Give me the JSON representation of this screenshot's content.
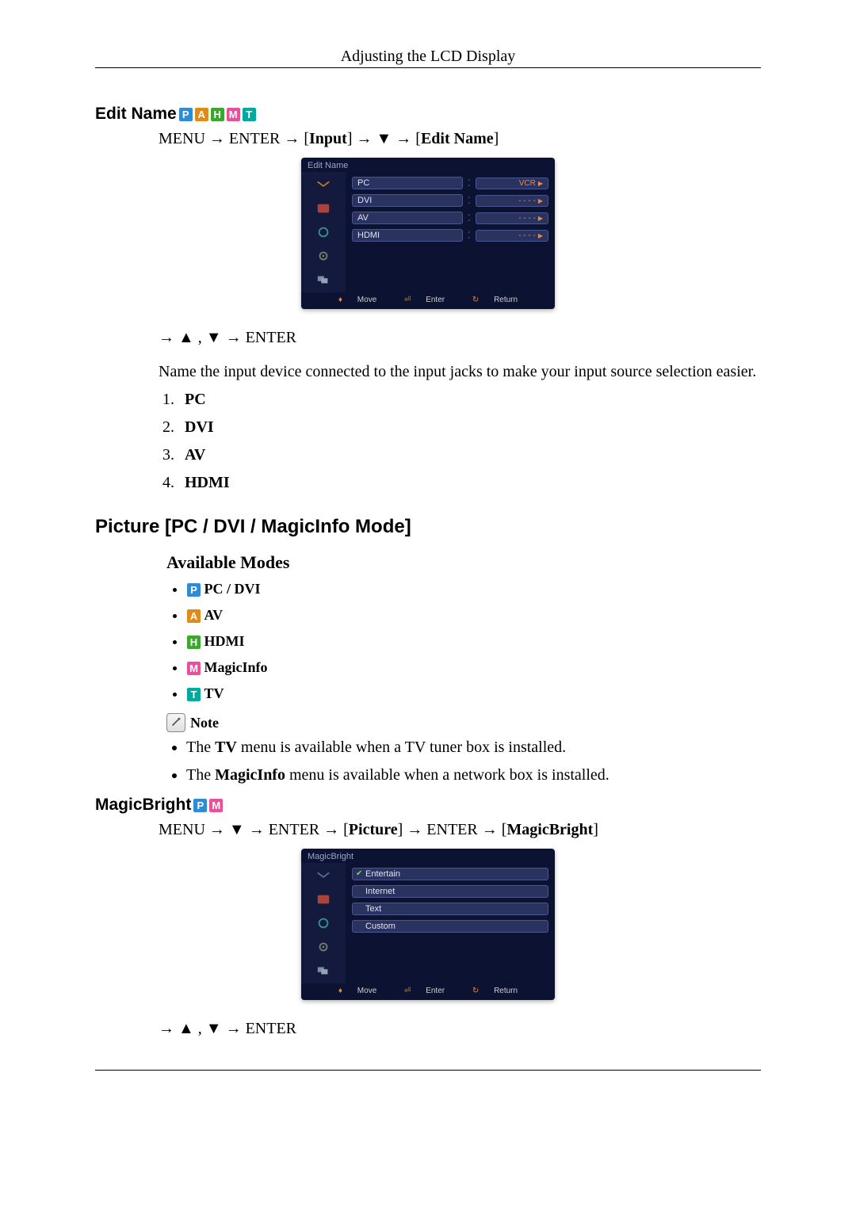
{
  "header": {
    "title": "Adjusting the LCD Display"
  },
  "badges": {
    "P": "P",
    "A": "A",
    "H": "H",
    "M": "M",
    "T": "T"
  },
  "editName": {
    "title": "Edit Name",
    "pathParts": [
      "MENU",
      " → ",
      "ENTER",
      " → [",
      "Input",
      "] → ",
      "▼",
      " → [",
      "Edit Name",
      "]"
    ],
    "osd": {
      "title": "Edit Name",
      "rows": [
        {
          "label": "PC",
          "value": "VCR",
          "arrow": true
        },
        {
          "label": "DVI",
          "value": "- - - -",
          "arrow": true
        },
        {
          "label": "AV",
          "value": "- - - -",
          "arrow": true
        },
        {
          "label": "HDMI",
          "value": "- - - -",
          "arrow": true
        }
      ],
      "footer": {
        "move": "Move",
        "enter": "Enter",
        "return": "Return"
      }
    },
    "navKeys": "→ ▲ , ▼ → ENTER",
    "desc": "Name the input device connected to the input jacks to make your input source selection easier.",
    "list": [
      "PC",
      "DVI",
      "AV",
      "HDMI"
    ]
  },
  "picture": {
    "title": "Picture [PC / DVI / MagicInfo Mode]",
    "modesTitle": "Available Modes",
    "modes": [
      "PC / DVI",
      "AV",
      "HDMI",
      "MagicInfo",
      "TV"
    ],
    "noteLabel": "Note",
    "notes": [
      {
        "pre": "The ",
        "b": "TV",
        "post": " menu is available when a TV tuner box is installed."
      },
      {
        "pre": "The ",
        "b": "MagicInfo",
        "post": " menu is available when a network box is installed."
      }
    ]
  },
  "magicBright": {
    "title": "MagicBright",
    "pathParts": [
      "MENU",
      " → ",
      "▼",
      " → ",
      "ENTER",
      " → [",
      "Picture",
      "] → ",
      "ENTER",
      " → [",
      "MagicBright",
      "]"
    ],
    "osd": {
      "title": "MagicBright",
      "rows": [
        {
          "label": "Entertain",
          "checked": true
        },
        {
          "label": "Internet"
        },
        {
          "label": "Text"
        },
        {
          "label": "Custom"
        }
      ],
      "footer": {
        "move": "Move",
        "enter": "Enter",
        "return": "Return"
      }
    },
    "navKeys": "→ ▲ , ▼ → ENTER"
  }
}
